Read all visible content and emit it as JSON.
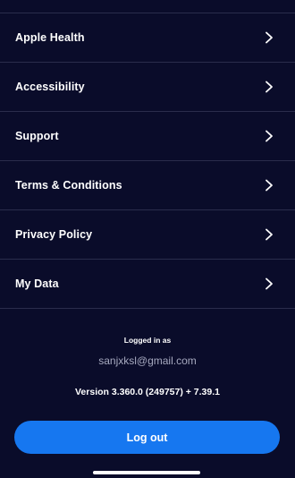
{
  "settings": {
    "items": [
      {
        "label": "Apple Health",
        "icon": "chevron-right-icon"
      },
      {
        "label": "Accessibility",
        "icon": "chevron-right-icon"
      },
      {
        "label": "Support",
        "icon": "chevron-right-icon"
      },
      {
        "label": "Terms & Conditions",
        "icon": "chevron-right-icon"
      },
      {
        "label": "Privacy Policy",
        "icon": "chevron-right-icon"
      },
      {
        "label": "My Data",
        "icon": "chevron-right-icon"
      }
    ]
  },
  "account": {
    "logged_in_label": "Logged in as",
    "email": "sanjxksl@gmail.com",
    "version": "Version 3.360.0 (249757) + 7.39.1"
  },
  "actions": {
    "logout_label": "Log out"
  },
  "colors": {
    "background": "#0a0c2a",
    "divider": "#2a2d4c",
    "accent": "#1677f0",
    "muted_text": "#a6a9bf"
  }
}
